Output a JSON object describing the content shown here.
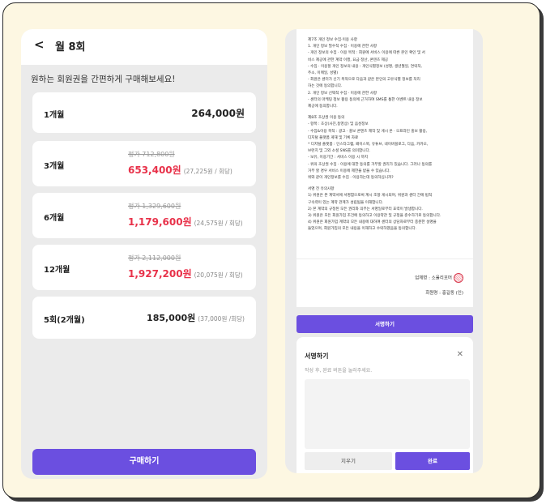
{
  "left": {
    "back_icon": "chevron-left-icon",
    "back_glyph": "<",
    "title": "월 8회",
    "subtitle": "원하는 회원권을 간편하게 구매해보세요!",
    "plans": [
      {
        "name": "1개월",
        "price": "264,000원"
      },
      {
        "name": "3개월",
        "original": "정가 712,800원",
        "sale": "653,400원",
        "per": "(27,225원 / 회당)"
      },
      {
        "name": "6개월",
        "original": "정가 1,329,600원",
        "sale": "1,179,600원",
        "per": "(24,575원 / 회당)"
      },
      {
        "name": "12개월",
        "original": "정가 2,112,000원",
        "sale": "1,927,200원",
        "per": "(20,075원 / 회당)"
      },
      {
        "name": "5회(2개월)",
        "price": "185,000원",
        "per": "(37,000원 /회당)"
      }
    ],
    "buy_label": "구매하기"
  },
  "right": {
    "doc_lines": [
      "제7조 개인 정보 수집·이용 사항",
      "1. 개인 정보 필수적 수집 · 이용에 관한 사항",
      " - 개인 정보의 수집 · 이용 목적 : 회원에 서비스 이용에 따른 본인 확인 및 서",
      "   비스 제공에 관한 계약 이행, 요금 정산, 콘텐츠 제공",
      " - 수집 · 이용할 개인 정보의 내용 : 개인식별정보 (성명, 생년월일, 연락처,",
      "   주소, 이메일, 성별)",
      " - 회원은 센터가 신기 목적으로 다음과 같은 본인의 고유식별 정보를 처리",
      "   하는 것에 동의합니다.",
      "2. 개인 정보 선택적 수집 · 이용에 관한 사항",
      " - 센터의 마케팅 정보 활용 동의에 근거하여 SMS를 통한 이벤트 내용 정보",
      "   제공에 동의합니다.",
      "",
      "제8조 초상권 이용 동의",
      " - 항목 : 초상(사진,동영상) 및 음성정보",
      " - 수집&이용 목적 : 광고 · 홍보 콘텐츠 제작 및 게시 온 · 오프라인 홍보 활용,",
      "   디지털 플랫폼 게재 및 기록 자료",
      " * 디지털 플랫폼 : 인스타그램, 페이스북, 유튜브, 네이버블로그, 다음, 카카오,",
      "   브런치 및 그외 소셜 SNS를 의미합니다.",
      " - 보유, 이용기간 : 서비스 이용 시 까지",
      " - 위의 초상권 수집 · 이용에 대한 동의를 거부할 권리가 있습니다. 그러나 동의를",
      "   거부 할 경우 서비스 이용에 제한을 받을 수 있습니다.",
      "   위와 같이 개인정보를 수집 · 이용하는데 동의하십니까?",
      "",
      "서명 전 유의사항",
      "1) 위원은 본 계약서에 서명함으로써 계시 조항 게시되며, 위원과 센터 간에 법적",
      "   구속력이 있는 계약 관계가 성립됨을 이해합니다.",
      "2) 본 계약의 규정된 모든 권리와 의무는 서명일로부터 효력이 발생합니다.",
      "3) 위원은 모든 회원가입 조건에 동의하고 이용약관 및 규정을 준수하기로 동의합니다.",
      "4) 위원은 회원가입 계약의 모든 내용에 대하여 센터의 상담자로부터 충분한 설명을",
      "   들었으며, 회원가입의 모든 내용을 이해하고 수락하였음을 동의합니다."
    ],
    "company_label": "업체명 : 소울리포머",
    "member_label": "회원명 : 홍길동 (인)",
    "sign_button": "서명하기",
    "modal": {
      "title": "서명하기",
      "close_glyph": "✕",
      "hint": "작성 후, 완료 버튼을 눌러주세요.",
      "clear_label": "지우기",
      "done_label": "완료"
    }
  },
  "colors": {
    "accent": "#6b4fe0",
    "sale": "#e8324a",
    "frame_bg": "#fdf7e2"
  }
}
